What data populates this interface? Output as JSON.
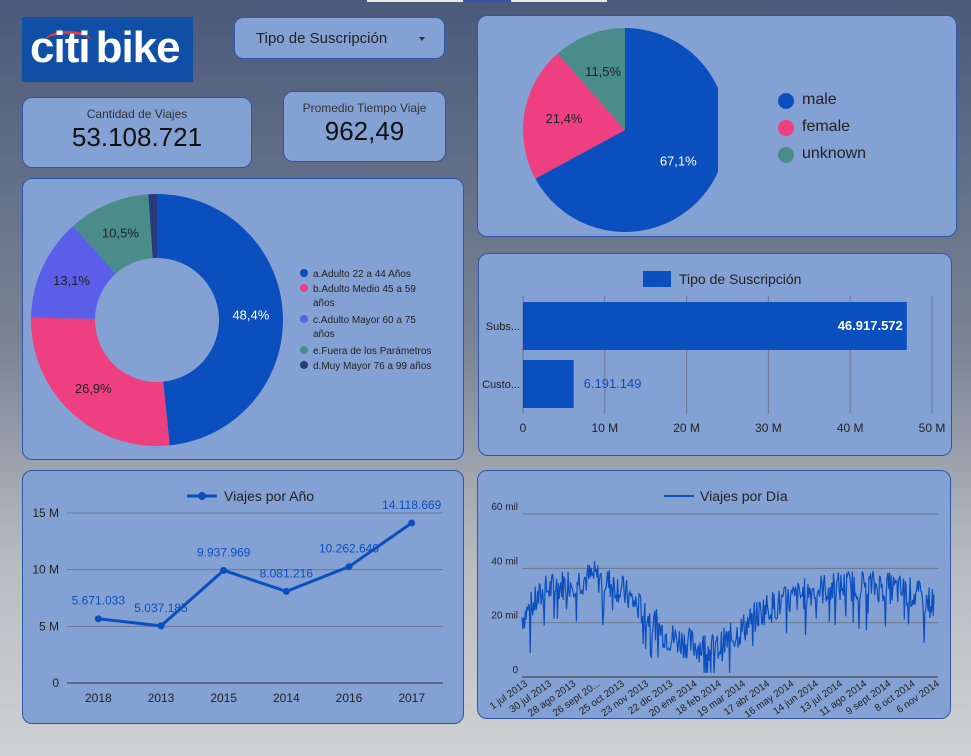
{
  "logo": {
    "text": "citibike",
    "color": "#0f4fa6"
  },
  "filter": {
    "label": "Tipo de Suscripción",
    "icon": "caret-down-icon"
  },
  "kpis": {
    "trips": {
      "label": "Cantidad de Viajes",
      "value": "53.108.721"
    },
    "avg_time": {
      "label": "Promedio Tiempo Viaje",
      "value": "962,49"
    }
  },
  "colors": {
    "card_bg": "#84a1d3",
    "card_border": "#2f56a8",
    "series_blue": "#0b4fbf"
  },
  "chart_data": [
    {
      "id": "gender",
      "type": "pie",
      "categories": [
        "male",
        "female",
        "unknown"
      ],
      "values": [
        67.1,
        21.4,
        11.5
      ],
      "labels": [
        "67,1%",
        "21,4%",
        "11,5%"
      ],
      "colors": [
        "#0b4fbf",
        "#ee4080",
        "#4a8c8a"
      ],
      "legend_position": "right"
    },
    {
      "id": "age",
      "type": "pie",
      "donut": true,
      "categories": [
        "a.Adulto 22 a 44 Años",
        "b.Adulto Medio 45 a 59 años",
        "c.Adulto Mayor 60 a 75 años",
        "e.Fuera de los Parámetros",
        "d.Muy Mayor 76 a 99 años"
      ],
      "values": [
        48.4,
        26.9,
        13.1,
        10.5,
        1.1
      ],
      "labels": [
        "48,4%",
        "26,9%",
        "13,1%",
        "10,5%",
        ""
      ],
      "colors": [
        "#0b4fbf",
        "#ee4080",
        "#5a5ee8",
        "#4a8c8a",
        "#283a78"
      ],
      "legend_position": "right"
    },
    {
      "id": "subscription",
      "type": "bar",
      "orientation": "horizontal",
      "title": "Tipo de Suscripción",
      "categories": [
        "Subs...",
        "Custo..."
      ],
      "values": [
        46917572,
        6191149
      ],
      "value_labels": [
        "46.917.572",
        "6.191.149"
      ],
      "xlim": [
        0,
        50000000
      ],
      "x_ticks": [
        "0",
        "10 M",
        "20 M",
        "30 M",
        "40 M",
        "50 M"
      ],
      "grid": true,
      "color": "#0b4fbf",
      "legend_position": "top"
    },
    {
      "id": "per_year",
      "type": "line",
      "title": "Viajes por Año",
      "categories": [
        "2018",
        "2013",
        "2015",
        "2014",
        "2016",
        "2017"
      ],
      "values": [
        5671033,
        5037185,
        9937969,
        8081216,
        10262649,
        14118669
      ],
      "value_labels": [
        "5.671.033",
        "5.037.185",
        "9.937.969",
        "8.081.216",
        "10.262.649",
        "14.118.669"
      ],
      "ylim": [
        0,
        15000000
      ],
      "y_ticks": [
        "0",
        "5 M",
        "10 M",
        "15 M"
      ],
      "grid": true,
      "color": "#0b4fbf",
      "legend_position": "top"
    },
    {
      "id": "per_day",
      "type": "line",
      "title": "Viajes por Día",
      "ylim": [
        0,
        60000
      ],
      "y_ticks": [
        "0",
        "20 mil",
        "40 mil",
        "60 mil"
      ],
      "x_ticks": [
        "1 jul 2013",
        "30 jul 2013",
        "28 ago 2013",
        "26 sept 20...",
        "25 oct 2013",
        "23 nov 2013",
        "22 dic 2013",
        "20 ene 2014",
        "18 feb 2014",
        "19 mar 2014",
        "17 abr 2014",
        "16 may 2014",
        "14 jun 2014",
        "13 jul 2014",
        "11 ago 2014",
        "9 sept 2014",
        "8 oct 2014",
        "6 nov 2014"
      ],
      "envelope": [
        {
          "x": "1 jul 2013",
          "y": 22000
        },
        {
          "x": "30 jul 2013",
          "y": 32000
        },
        {
          "x": "28 ago 2013",
          "y": 35000
        },
        {
          "x": "26 sept 20...",
          "y": 37000
        },
        {
          "x": "25 oct 2013",
          "y": 33000
        },
        {
          "x": "23 nov 2013",
          "y": 24000
        },
        {
          "x": "22 dic 2013",
          "y": 15000
        },
        {
          "x": "20 ene 2014",
          "y": 12000
        },
        {
          "x": "18 feb 2014",
          "y": 10000
        },
        {
          "x": "19 mar 2014",
          "y": 17000
        },
        {
          "x": "17 abr 2014",
          "y": 25000
        },
        {
          "x": "16 may 2014",
          "y": 28000
        },
        {
          "x": "14 jun 2014",
          "y": 32000
        },
        {
          "x": "13 jul 2014",
          "y": 33000
        },
        {
          "x": "11 ago 2014",
          "y": 34000
        },
        {
          "x": "9 sept 2014",
          "y": 33000
        },
        {
          "x": "8 oct 2014",
          "y": 31000
        },
        {
          "x": "6 nov 2014",
          "y": 27000
        }
      ],
      "grid": true,
      "color": "#0b4fbf",
      "legend_position": "top"
    }
  ]
}
